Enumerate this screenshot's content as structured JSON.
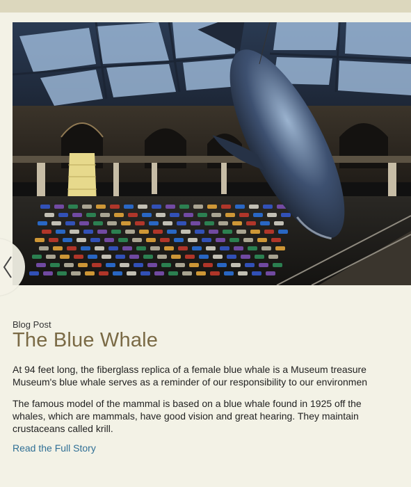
{
  "carousel": {
    "image_alt": "Photo of the Museum hall with a blue whale model hanging above rows of sleeping bags",
    "prev_icon": "chevron-left-icon"
  },
  "post": {
    "kicker": "Blog Post",
    "title": "The Blue Whale",
    "paragraph1": [
      "At 94 feet long, the fiberglass replica of a female blue whale is a Museum treasure",
      "Museum's blue whale serves as a reminder of our responsibility to our environmen"
    ],
    "paragraph2": [
      "The famous model of the mammal is based on a blue whale found in 1925 off the",
      "whales, which are mammals, have good vision and great hearing. They maintain",
      "crustaceans called krill."
    ],
    "read_more": "Read the Full Story"
  },
  "colors": {
    "background": "#f3f2e6",
    "title": "#7a6a45",
    "link": "#2f6f95",
    "text": "#222222"
  }
}
